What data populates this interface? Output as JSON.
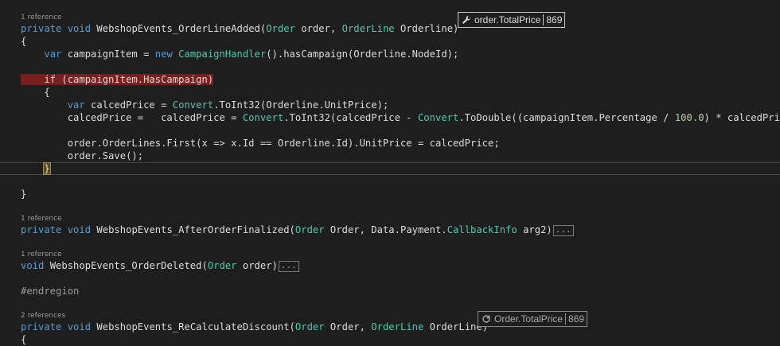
{
  "code": {
    "refs": {
      "r1": "1 reference",
      "r2": "1 reference",
      "r3": "1 reference",
      "r4": "2 references"
    },
    "lines": {
      "l1": {
        "kw1": "private",
        "kw2": "void",
        "name": "WebshopEvents_OrderLineAdded(",
        "t1": "Order",
        "p1": " order, ",
        "t2": "OrderLine",
        "p2": " Orderline)"
      },
      "l2": "{",
      "l3": {
        "a": "    ",
        "kw": "var",
        "b": " campaignItem = ",
        "kw2": "new",
        "c": " ",
        "t": "CampaignHandler",
        "d": "().hasCampaign(Orderline.NodeId);"
      },
      "l4": "    if (campaignItem.HasCampaign)",
      "l5": "    {",
      "l6": {
        "a": "        ",
        "kw": "var",
        "b": " calcedPrice = ",
        "t": "Convert",
        "c": ".ToInt32(Orderline.UnitPrice);"
      },
      "l7": {
        "a": "        calcedPrice =   calcedPrice = ",
        "t1": "Convert",
        "b": ".ToInt32(calcedPrice - ",
        "t2": "Convert",
        "c": ".ToDouble((campaignItem.Percentage / ",
        "n": "100.0",
        "d": ") * calcedPrice));"
      },
      "l8": "        order.OrderLines.First(x => x.Id == Orderline.Id).UnitPrice = calcedPrice;",
      "l9": "        order.Save();",
      "l10": "}",
      "l11": "}",
      "l12": {
        "kw1": "private",
        "kw2": "void",
        "name": "WebshopEvents_AfterOrderFinalized(",
        "t1": "Order",
        "p1": " Order, Data.Payment.",
        "t2": "CallbackInfo",
        "p2": " arg2)",
        "ellipsis": "..."
      },
      "l13": {
        "kw": "void",
        "name": "WebshopEvents_OrderDeleted(",
        "t": "Order",
        "p": " order)",
        "ellipsis": "..."
      },
      "l14": "#endregion",
      "l15": {
        "kw1": "private",
        "kw2": "void",
        "name": "WebshopEvents_ReCalculateDiscount(",
        "t1": "Order",
        "p1": " Order, ",
        "t2": "OrderLine",
        "p2": " OrderLine)"
      },
      "l16": "{"
    }
  },
  "datatips": [
    {
      "icon": "wrench-icon",
      "expression": "order.TotalPrice",
      "value": "869"
    },
    {
      "icon": "refresh-icon",
      "expression": "Order.TotalPrice",
      "value": "869"
    }
  ],
  "colors": {
    "background": "#1e1e1e",
    "keyword": "#569cd6",
    "type": "#4ec9b0",
    "number": "#b5cea8",
    "text": "#dcdcdc",
    "breakpoint_highlight": "#7a1f1f"
  }
}
